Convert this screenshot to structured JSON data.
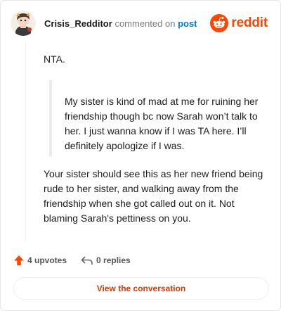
{
  "comment": {
    "author": "Crisis_Redditor",
    "action_text": "commented on",
    "target_link": "post",
    "body": {
      "paragraph_1": "NTA.",
      "quote": "My sister is kind of mad at me for ruining her friendship though bc now Sarah won’t talk to her. I just wanna know if I was TA here. I’ll definitely apologize if I was.",
      "paragraph_2": "Your sister should see this as her new friend being rude to her sister, and walking away from the friendship when she got called out on it. Not blaming Sarah's pettiness on you."
    }
  },
  "brand": {
    "wordmark": "reddit",
    "color": "#ff4500"
  },
  "stats": {
    "upvotes_label": "4 upvotes",
    "replies_label": "0 replies"
  },
  "cta": {
    "label": "View the conversation"
  },
  "icons": {
    "avatar": "avatar-icon",
    "logo": "reddit-logo-icon",
    "upvote": "upvote-arrow-icon",
    "reply": "reply-arrow-icon"
  }
}
